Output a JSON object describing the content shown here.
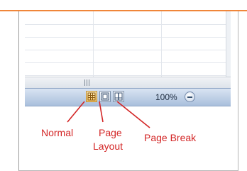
{
  "status_bar": {
    "zoom_level": "100%",
    "view_buttons": [
      {
        "name": "Normal",
        "icon": "normal-view-icon",
        "active": true
      },
      {
        "name": "Page Layout",
        "icon": "page-layout-view-icon",
        "active": false
      },
      {
        "name": "Page Break",
        "icon": "page-break-preview-icon",
        "active": false
      }
    ],
    "zoom_out_icon": "minus-circle-icon"
  },
  "annotations": {
    "normal": "Normal",
    "page_line1": "Page",
    "page_line2": "Layout",
    "page_break": "Page Break"
  },
  "colors": {
    "accent_rule": "#f0863a",
    "callout_red": "#d32525",
    "statusbar_top": "#d9e4f2",
    "statusbar_bottom": "#a9bfdc",
    "active_button": "#f7c96a"
  }
}
